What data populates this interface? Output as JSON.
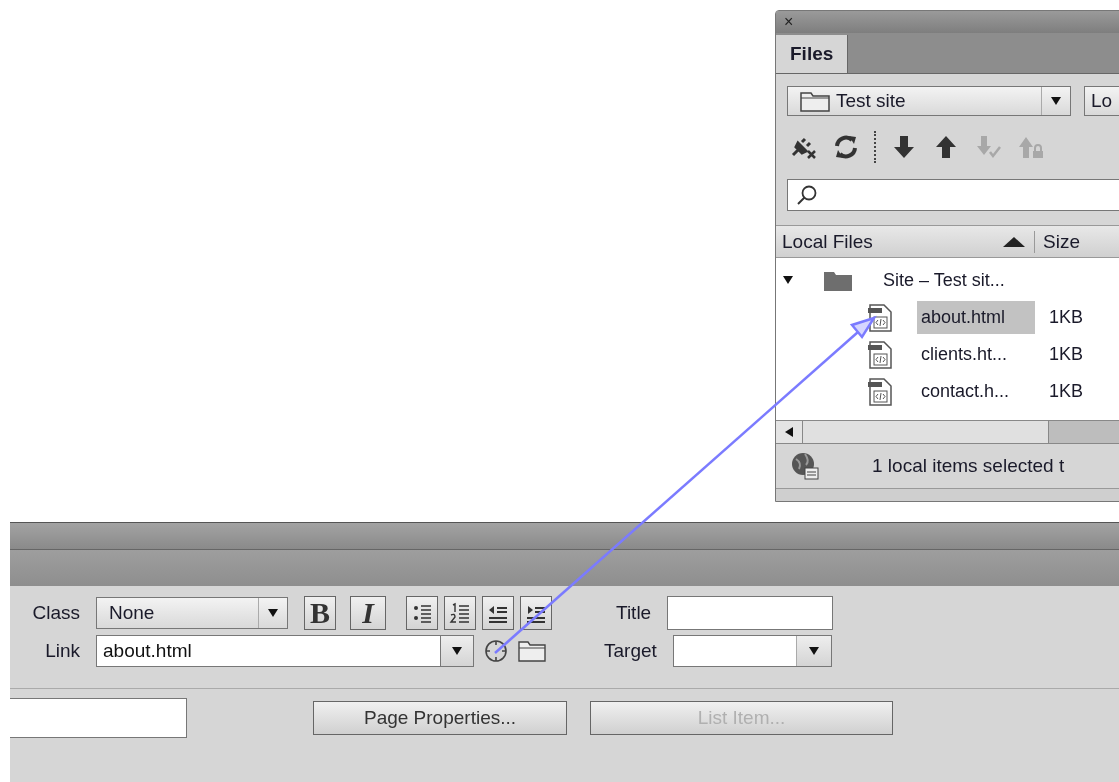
{
  "files_panel": {
    "close": "×",
    "tabs": [
      {
        "label": "Files",
        "selected": true
      }
    ],
    "site_select": {
      "value": "Test site"
    },
    "view_select": {
      "value": "Lo"
    },
    "toolbar": [
      {
        "kind": "disconnect",
        "disabled": false
      },
      {
        "kind": "refresh",
        "disabled": false
      },
      {
        "kind": "get",
        "disabled": false
      },
      {
        "kind": "put",
        "disabled": false
      },
      {
        "kind": "checkout",
        "disabled": true
      },
      {
        "kind": "checkin",
        "disabled": true
      }
    ],
    "columns": [
      "Local Files",
      "Size"
    ],
    "tree": [
      {
        "name": "Site – Test sit...",
        "expanded": true,
        "children": [
          {
            "name": "about.html",
            "size": "1KB",
            "selected": true
          },
          {
            "name": "clients.ht...",
            "size": "1KB",
            "selected": false
          },
          {
            "name": "contact.h...",
            "size": "1KB",
            "selected": false
          }
        ]
      }
    ],
    "status": "1 local items selected t"
  },
  "property_inspector": {
    "class": {
      "label": "Class",
      "value": "None"
    },
    "format_buttons": [
      {
        "label": "B",
        "kind": "bold"
      },
      {
        "label": "I",
        "kind": "italic"
      }
    ],
    "list_buttons": [
      {
        "kind": "bullets"
      },
      {
        "kind": "numbers"
      },
      {
        "kind": "outdent"
      },
      {
        "kind": "indent"
      }
    ],
    "title": {
      "label": "Title"
    },
    "link": {
      "label": "Link",
      "value": "about.html"
    },
    "target": {
      "label": "Target"
    },
    "buttons": [
      {
        "label": "Page Properties...",
        "disabled": false
      },
      {
        "label": "List Item...",
        "disabled": true
      }
    ]
  }
}
